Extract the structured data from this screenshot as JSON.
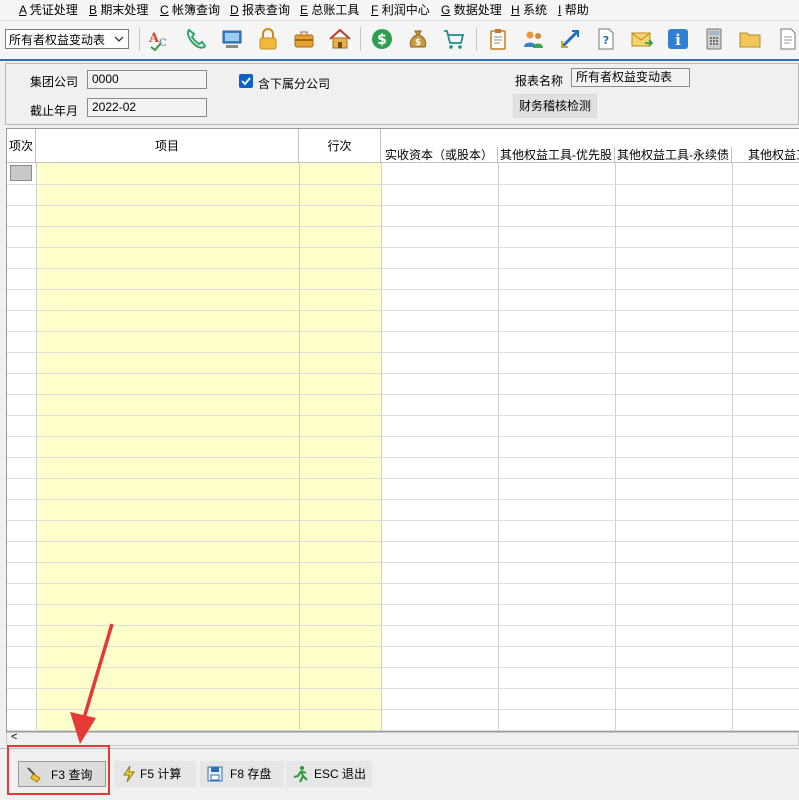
{
  "menu": [
    {
      "key": "A",
      "label": "凭证处理"
    },
    {
      "key": "B",
      "label": "期末处理"
    },
    {
      "key": "C",
      "label": "帐簿查询"
    },
    {
      "key": "D",
      "label": "报表查询"
    },
    {
      "key": "E",
      "label": "总账工具"
    },
    {
      "key": "F",
      "label": "利润中心"
    },
    {
      "key": "G",
      "label": "数据处理"
    },
    {
      "key": "H",
      "label": "系统"
    },
    {
      "key": "I",
      "label": "帮助"
    }
  ],
  "toolbar": {
    "report_select_value": "所有者权益变动表",
    "icons": [
      "spellcheck-icon",
      "phone-icon",
      "computer-icon",
      "lock-icon",
      "briefcase-icon",
      "home-icon",
      "dollar-icon",
      "money-bag-icon",
      "cart-icon",
      "clipboard-icon",
      "users-icon",
      "transfer-icon",
      "help-doc-icon",
      "mail-icon",
      "info-icon",
      "calculator-icon",
      "folder-icon",
      "document-icon"
    ]
  },
  "filters": {
    "group_company_label": "集团公司",
    "group_company_value": "0000",
    "include_sub_label": "含下属分公司",
    "include_sub_checked": true,
    "period_label": "截止年月",
    "period_value": "2022-02",
    "report_name_label": "报表名称",
    "report_name_value": "所有者权益变动表",
    "check_button": "财务稽核检测"
  },
  "grid": {
    "headers": {
      "index": "项次",
      "item": "项目",
      "row": "行次",
      "col1": "实收资本（或股本）",
      "col2": "其他权益工具-优先股",
      "col3": "其他权益工具-永续债",
      "col4": "其他权益工"
    },
    "row_count": 27
  },
  "scroll_left": "<",
  "actions": {
    "query": "F3 查询",
    "calc": "F5 计算",
    "save": "F8 存盘",
    "exit": "ESC 退出"
  },
  "colors": {
    "accent": "#2f6db5",
    "highlight": "#e53935",
    "yellow_col": "#ffffcc"
  }
}
